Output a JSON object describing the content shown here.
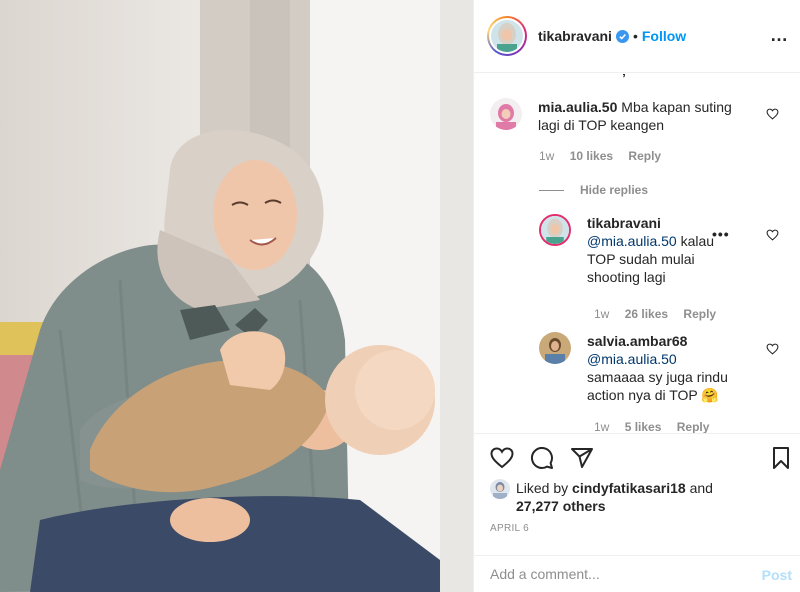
{
  "colors": {
    "accent": "#0095f6",
    "muted": "#8e8e8e",
    "text": "#262626",
    "post_disabled": "#b2dffc"
  },
  "header": {
    "username": "tikabravani",
    "separator": "•",
    "follow_label": "Follow",
    "more_icon": "ellipsis-icon"
  },
  "comments": [
    {
      "username": "mia.aulia.50",
      "text": "Mba kapan suting lagi di TOP keangen",
      "time": "1w",
      "likes": "10 likes",
      "reply": "Reply"
    }
  ],
  "hide_replies_label": "Hide replies",
  "replies": [
    {
      "username": "tikabravani",
      "mention": "@mia.aulia.50",
      "text": "kalau TOP sudah mulai shooting lagi",
      "time": "1w",
      "likes": "26 likes",
      "reply": "Reply"
    },
    {
      "username": "salvia.ambar68",
      "mention": "@mia.aulia.50",
      "text": "samaaaa sy juga rindu action nya di TOP 🤗",
      "time": "1w",
      "likes": "5 likes",
      "reply": "Reply"
    }
  ],
  "liked_by": {
    "prefix": "Liked by",
    "user": "cindyfatikasari18",
    "and": "and",
    "others": "27,277 others"
  },
  "date": "APRIL 6",
  "comment_box": {
    "placeholder": "Add a comment...",
    "post_label": "Post"
  },
  "icons": [
    "heart-icon",
    "comment-icon",
    "share-icon",
    "bookmark-icon",
    "verified-badge-icon"
  ]
}
